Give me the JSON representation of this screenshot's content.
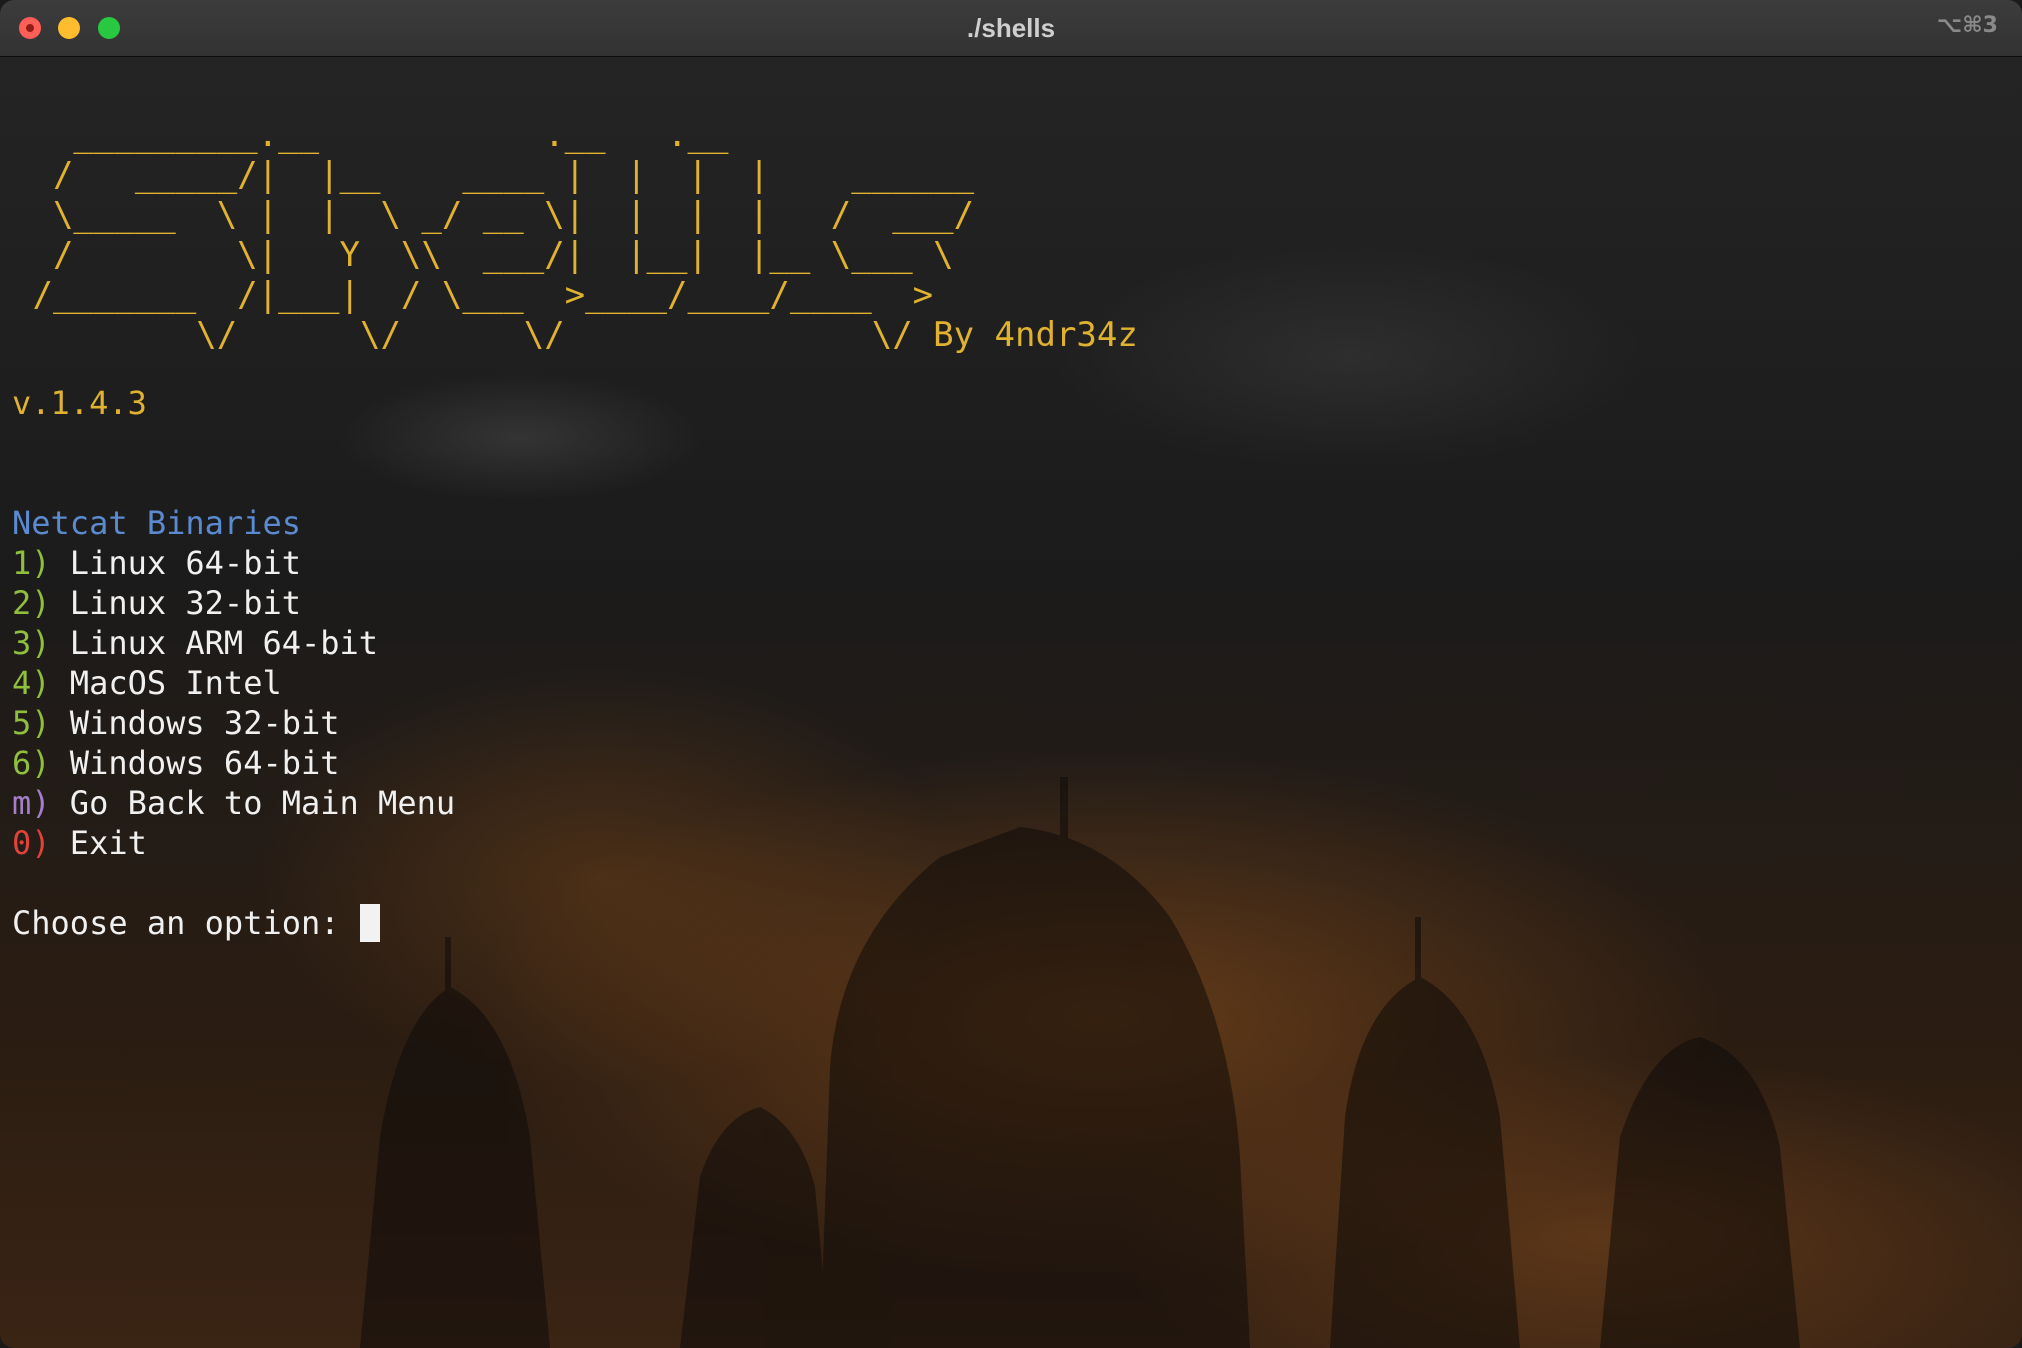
{
  "window": {
    "title": "./shells",
    "shortcut": "⌥⌘3"
  },
  "banner": {
    "ascii_art": "   _________.__           .__   .__\n  /   _____/|  |__    ____ |  |  |  |    ______\n  \\_____  \\ |  |  \\ _/ __ \\|  |  |  |   /  ___/\n  /        \\|   Y  \\\\  ___/|  |__|  |__ \\___ \\\n /_______  /|___|  / \\___  >____/____/____  >\n         \\/      \\/      \\/               \\/ By 4ndr34z",
    "version": "v.1.4.3"
  },
  "menu": {
    "header": "Netcat Binaries",
    "items": [
      {
        "key": "1)",
        "label": "Linux 64-bit",
        "key_color": "#8fbf3d"
      },
      {
        "key": "2)",
        "label": "Linux 32-bit",
        "key_color": "#8fbf3d"
      },
      {
        "key": "3)",
        "label": "Linux ARM 64-bit",
        "key_color": "#8fbf3d"
      },
      {
        "key": "4)",
        "label": "MacOS Intel",
        "key_color": "#8fbf3d"
      },
      {
        "key": "5)",
        "label": "Windows 32-bit",
        "key_color": "#8fbf3d"
      },
      {
        "key": "6)",
        "label": "Windows 64-bit",
        "key_color": "#8fbf3d"
      },
      {
        "key": "m)",
        "label": "Go Back to Main Menu",
        "key_color": "#a57fc9"
      },
      {
        "key": "0)",
        "label": "Exit",
        "key_color": "#e0433a"
      }
    ]
  },
  "prompt": {
    "text": "Choose an option:"
  },
  "colors": {
    "banner": "#e1b230",
    "header": "#5b8ad1",
    "text": "#f0f0f0"
  }
}
